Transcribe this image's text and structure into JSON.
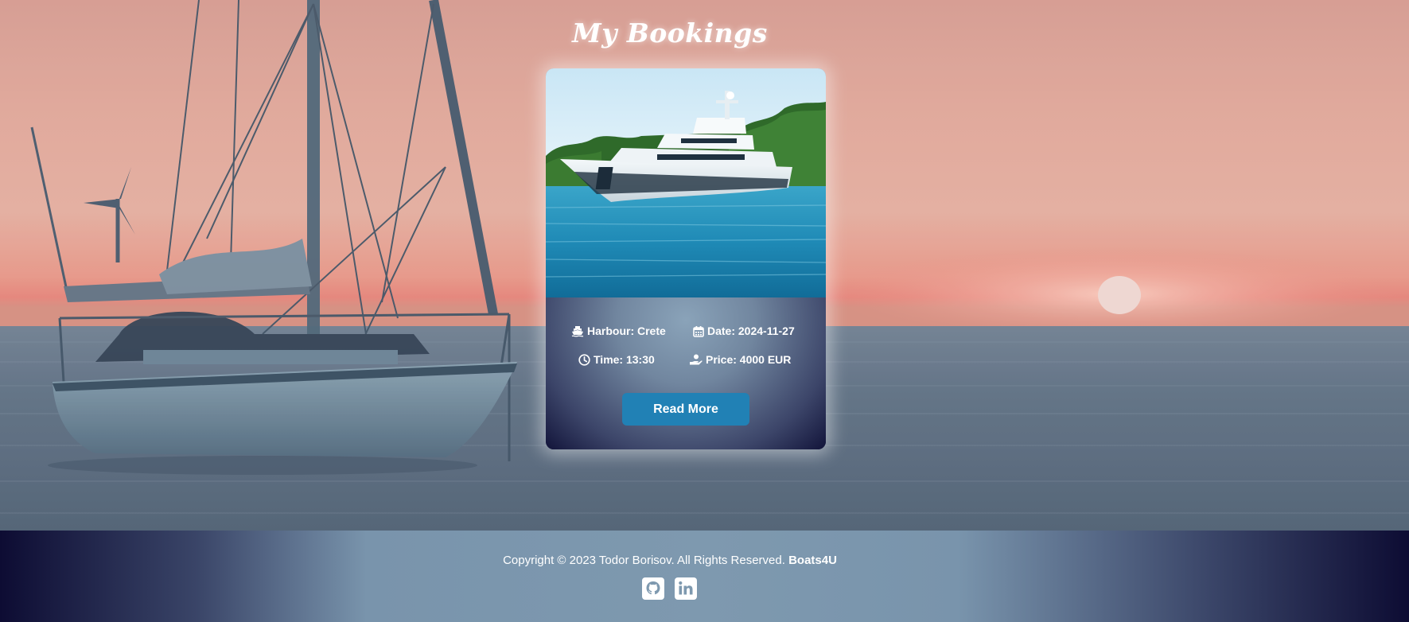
{
  "page": {
    "title": "My Bookings"
  },
  "booking": {
    "harbour": "Harbour: Crete",
    "date": "Date: 2024-11-27",
    "time": "Time: 13:30",
    "price": "Price: 4000 EUR",
    "read_more_label": "Read More",
    "icons": {
      "harbour": "ship-icon",
      "date": "calendar-icon",
      "time": "clock-icon",
      "price": "hand-holding-dollar-icon"
    }
  },
  "footer": {
    "copyright": "Copyright © 2023 Todor Borisov. All Rights Reserved.",
    "brand": "Boats4U",
    "social": [
      {
        "icon": "github-icon"
      },
      {
        "icon": "linkedin-icon"
      }
    ]
  },
  "colors": {
    "button": "#2181b5",
    "footer_edge": "#0d0c33",
    "footer_center": "#7e99af"
  }
}
